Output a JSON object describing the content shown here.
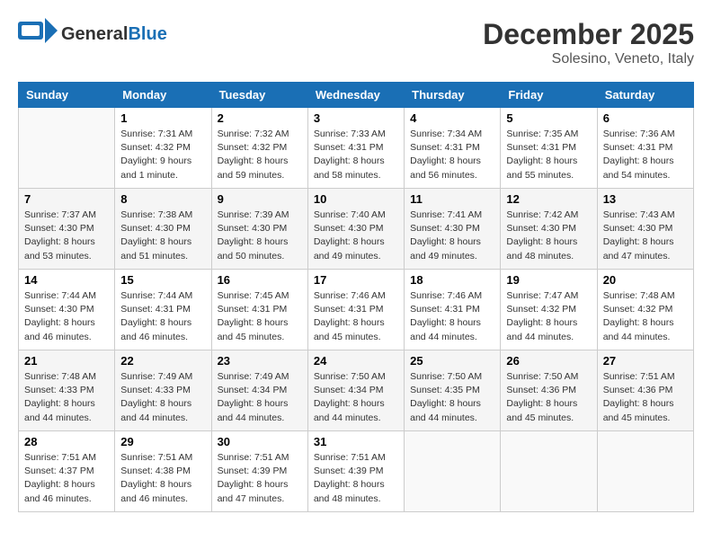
{
  "header": {
    "logo_line1": "General",
    "logo_line2": "Blue",
    "month": "December 2025",
    "location": "Solesino, Veneto, Italy"
  },
  "weekdays": [
    "Sunday",
    "Monday",
    "Tuesday",
    "Wednesday",
    "Thursday",
    "Friday",
    "Saturday"
  ],
  "weeks": [
    [
      {
        "day": "",
        "info": ""
      },
      {
        "day": "1",
        "info": "Sunrise: 7:31 AM\nSunset: 4:32 PM\nDaylight: 9 hours\nand 1 minute."
      },
      {
        "day": "2",
        "info": "Sunrise: 7:32 AM\nSunset: 4:32 PM\nDaylight: 8 hours\nand 59 minutes."
      },
      {
        "day": "3",
        "info": "Sunrise: 7:33 AM\nSunset: 4:31 PM\nDaylight: 8 hours\nand 58 minutes."
      },
      {
        "day": "4",
        "info": "Sunrise: 7:34 AM\nSunset: 4:31 PM\nDaylight: 8 hours\nand 56 minutes."
      },
      {
        "day": "5",
        "info": "Sunrise: 7:35 AM\nSunset: 4:31 PM\nDaylight: 8 hours\nand 55 minutes."
      },
      {
        "day": "6",
        "info": "Sunrise: 7:36 AM\nSunset: 4:31 PM\nDaylight: 8 hours\nand 54 minutes."
      }
    ],
    [
      {
        "day": "7",
        "info": "Sunrise: 7:37 AM\nSunset: 4:30 PM\nDaylight: 8 hours\nand 53 minutes."
      },
      {
        "day": "8",
        "info": "Sunrise: 7:38 AM\nSunset: 4:30 PM\nDaylight: 8 hours\nand 51 minutes."
      },
      {
        "day": "9",
        "info": "Sunrise: 7:39 AM\nSunset: 4:30 PM\nDaylight: 8 hours\nand 50 minutes."
      },
      {
        "day": "10",
        "info": "Sunrise: 7:40 AM\nSunset: 4:30 PM\nDaylight: 8 hours\nand 49 minutes."
      },
      {
        "day": "11",
        "info": "Sunrise: 7:41 AM\nSunset: 4:30 PM\nDaylight: 8 hours\nand 49 minutes."
      },
      {
        "day": "12",
        "info": "Sunrise: 7:42 AM\nSunset: 4:30 PM\nDaylight: 8 hours\nand 48 minutes."
      },
      {
        "day": "13",
        "info": "Sunrise: 7:43 AM\nSunset: 4:30 PM\nDaylight: 8 hours\nand 47 minutes."
      }
    ],
    [
      {
        "day": "14",
        "info": "Sunrise: 7:44 AM\nSunset: 4:30 PM\nDaylight: 8 hours\nand 46 minutes."
      },
      {
        "day": "15",
        "info": "Sunrise: 7:44 AM\nSunset: 4:31 PM\nDaylight: 8 hours\nand 46 minutes."
      },
      {
        "day": "16",
        "info": "Sunrise: 7:45 AM\nSunset: 4:31 PM\nDaylight: 8 hours\nand 45 minutes."
      },
      {
        "day": "17",
        "info": "Sunrise: 7:46 AM\nSunset: 4:31 PM\nDaylight: 8 hours\nand 45 minutes."
      },
      {
        "day": "18",
        "info": "Sunrise: 7:46 AM\nSunset: 4:31 PM\nDaylight: 8 hours\nand 44 minutes."
      },
      {
        "day": "19",
        "info": "Sunrise: 7:47 AM\nSunset: 4:32 PM\nDaylight: 8 hours\nand 44 minutes."
      },
      {
        "day": "20",
        "info": "Sunrise: 7:48 AM\nSunset: 4:32 PM\nDaylight: 8 hours\nand 44 minutes."
      }
    ],
    [
      {
        "day": "21",
        "info": "Sunrise: 7:48 AM\nSunset: 4:33 PM\nDaylight: 8 hours\nand 44 minutes."
      },
      {
        "day": "22",
        "info": "Sunrise: 7:49 AM\nSunset: 4:33 PM\nDaylight: 8 hours\nand 44 minutes."
      },
      {
        "day": "23",
        "info": "Sunrise: 7:49 AM\nSunset: 4:34 PM\nDaylight: 8 hours\nand 44 minutes."
      },
      {
        "day": "24",
        "info": "Sunrise: 7:50 AM\nSunset: 4:34 PM\nDaylight: 8 hours\nand 44 minutes."
      },
      {
        "day": "25",
        "info": "Sunrise: 7:50 AM\nSunset: 4:35 PM\nDaylight: 8 hours\nand 44 minutes."
      },
      {
        "day": "26",
        "info": "Sunrise: 7:50 AM\nSunset: 4:36 PM\nDaylight: 8 hours\nand 45 minutes."
      },
      {
        "day": "27",
        "info": "Sunrise: 7:51 AM\nSunset: 4:36 PM\nDaylight: 8 hours\nand 45 minutes."
      }
    ],
    [
      {
        "day": "28",
        "info": "Sunrise: 7:51 AM\nSunset: 4:37 PM\nDaylight: 8 hours\nand 46 minutes."
      },
      {
        "day": "29",
        "info": "Sunrise: 7:51 AM\nSunset: 4:38 PM\nDaylight: 8 hours\nand 46 minutes."
      },
      {
        "day": "30",
        "info": "Sunrise: 7:51 AM\nSunset: 4:39 PM\nDaylight: 8 hours\nand 47 minutes."
      },
      {
        "day": "31",
        "info": "Sunrise: 7:51 AM\nSunset: 4:39 PM\nDaylight: 8 hours\nand 48 minutes."
      },
      {
        "day": "",
        "info": ""
      },
      {
        "day": "",
        "info": ""
      },
      {
        "day": "",
        "info": ""
      }
    ]
  ]
}
